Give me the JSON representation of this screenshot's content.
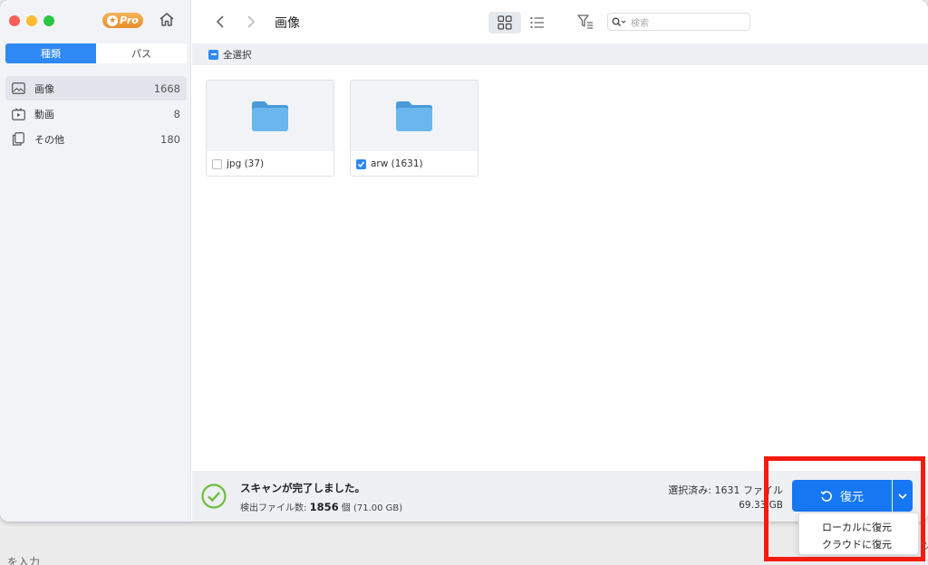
{
  "window": {
    "pro_label": "Pro",
    "segments": [
      {
        "label": "種類",
        "active": true
      },
      {
        "label": "パス",
        "active": false
      }
    ],
    "categories": [
      {
        "label": "画像",
        "count": "1668",
        "icon": "image-icon",
        "selected": true
      },
      {
        "label": "動画",
        "count": "8",
        "icon": "video-icon",
        "selected": false
      },
      {
        "label": "その他",
        "count": "180",
        "icon": "other-files-icon",
        "selected": false
      }
    ]
  },
  "toolbar": {
    "title": "画像",
    "search_placeholder": "検索"
  },
  "selectbar": {
    "select_all_label": "全選択"
  },
  "folders": [
    {
      "label": "jpg (37)",
      "checked": false
    },
    {
      "label": "arw (1631)",
      "checked": true
    }
  ],
  "footer": {
    "status_title": "スキャンが完了しました。",
    "found_prefix": "検出ファイル数:",
    "found_count": "1856",
    "found_suffix": "個 (71.00 GB)",
    "selected_info": "選択済み: 1631 ファイル",
    "selected_size": "69.33 GB"
  },
  "restore": {
    "button_label": "復元",
    "menu": [
      "ローカルに復元",
      "クラウドに復元"
    ]
  },
  "background": {
    "left_text": "を入力",
    "right_text": "ツ"
  },
  "colors": {
    "accent": "#1677f2",
    "highlight_border": "#f41b0e",
    "success": "#6cbf3f",
    "folder": "#5aa9e6"
  }
}
